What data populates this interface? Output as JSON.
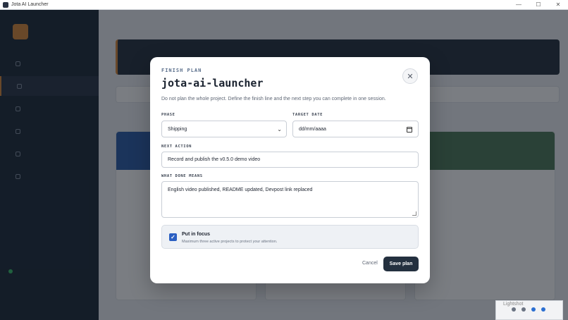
{
  "window": {
    "title": "Jota AI Launcher",
    "controls": [
      "—",
      "☐",
      "✕"
    ]
  },
  "modal": {
    "eyebrow": "FINISH PLAN",
    "title": "jota-ai-launcher",
    "description": "Do not plan the whole project. Define the finish line and the next step you can complete in one session.",
    "phase": {
      "label": "PHASE",
      "value": "Shipping"
    },
    "target_date": {
      "label": "TARGET DATE",
      "placeholder": "dd/mm/aaaa"
    },
    "next_action": {
      "label": "NEXT ACTION",
      "value": "Record and publish the v0.5.0 demo video"
    },
    "done_means": {
      "label": "WHAT DONE MEANS",
      "value": "English video published, README updated, Devpost link replaced"
    },
    "focus": {
      "checked": true,
      "title": "Put in focus",
      "help": "Maximum three active projects to protect your attention."
    },
    "cancel_label": "Cancel",
    "save_label": "Save plan",
    "close_symbol": "✕"
  },
  "tray": {
    "tooltip": "Lightshot"
  }
}
